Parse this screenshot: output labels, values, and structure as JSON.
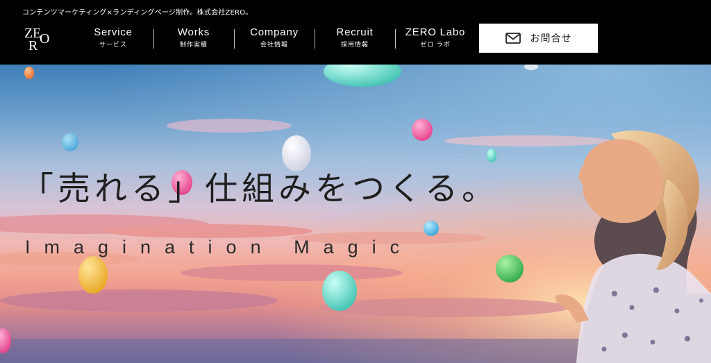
{
  "header": {
    "tagline": "コンテンツマーケティング×ランディングページ制作。株式会社ZERO。",
    "logo": {
      "icon": "zero-logo",
      "letters": [
        "Z",
        "E",
        "R",
        "O"
      ]
    },
    "nav": [
      {
        "en": "Service",
        "jp": "サービス"
      },
      {
        "en": "Works",
        "jp": "制作実績"
      },
      {
        "en": "Company",
        "jp": "会社情報"
      },
      {
        "en": "Recruit",
        "jp": "採用情報"
      },
      {
        "en": "ZERO Labo",
        "jp": "ゼロ ラボ"
      }
    ],
    "contact": {
      "label": "お問合せ",
      "icon": "mail-icon"
    }
  },
  "hero": {
    "headline": "「売れる」仕組みをつくる。",
    "subline": "Imagination Magic",
    "image": "sunset-sky-child-balloons"
  },
  "colors": {
    "header_bg": "#000000",
    "header_text": "#ffffff",
    "button_bg": "#ffffff",
    "headline_text": "#1f1f1f"
  }
}
